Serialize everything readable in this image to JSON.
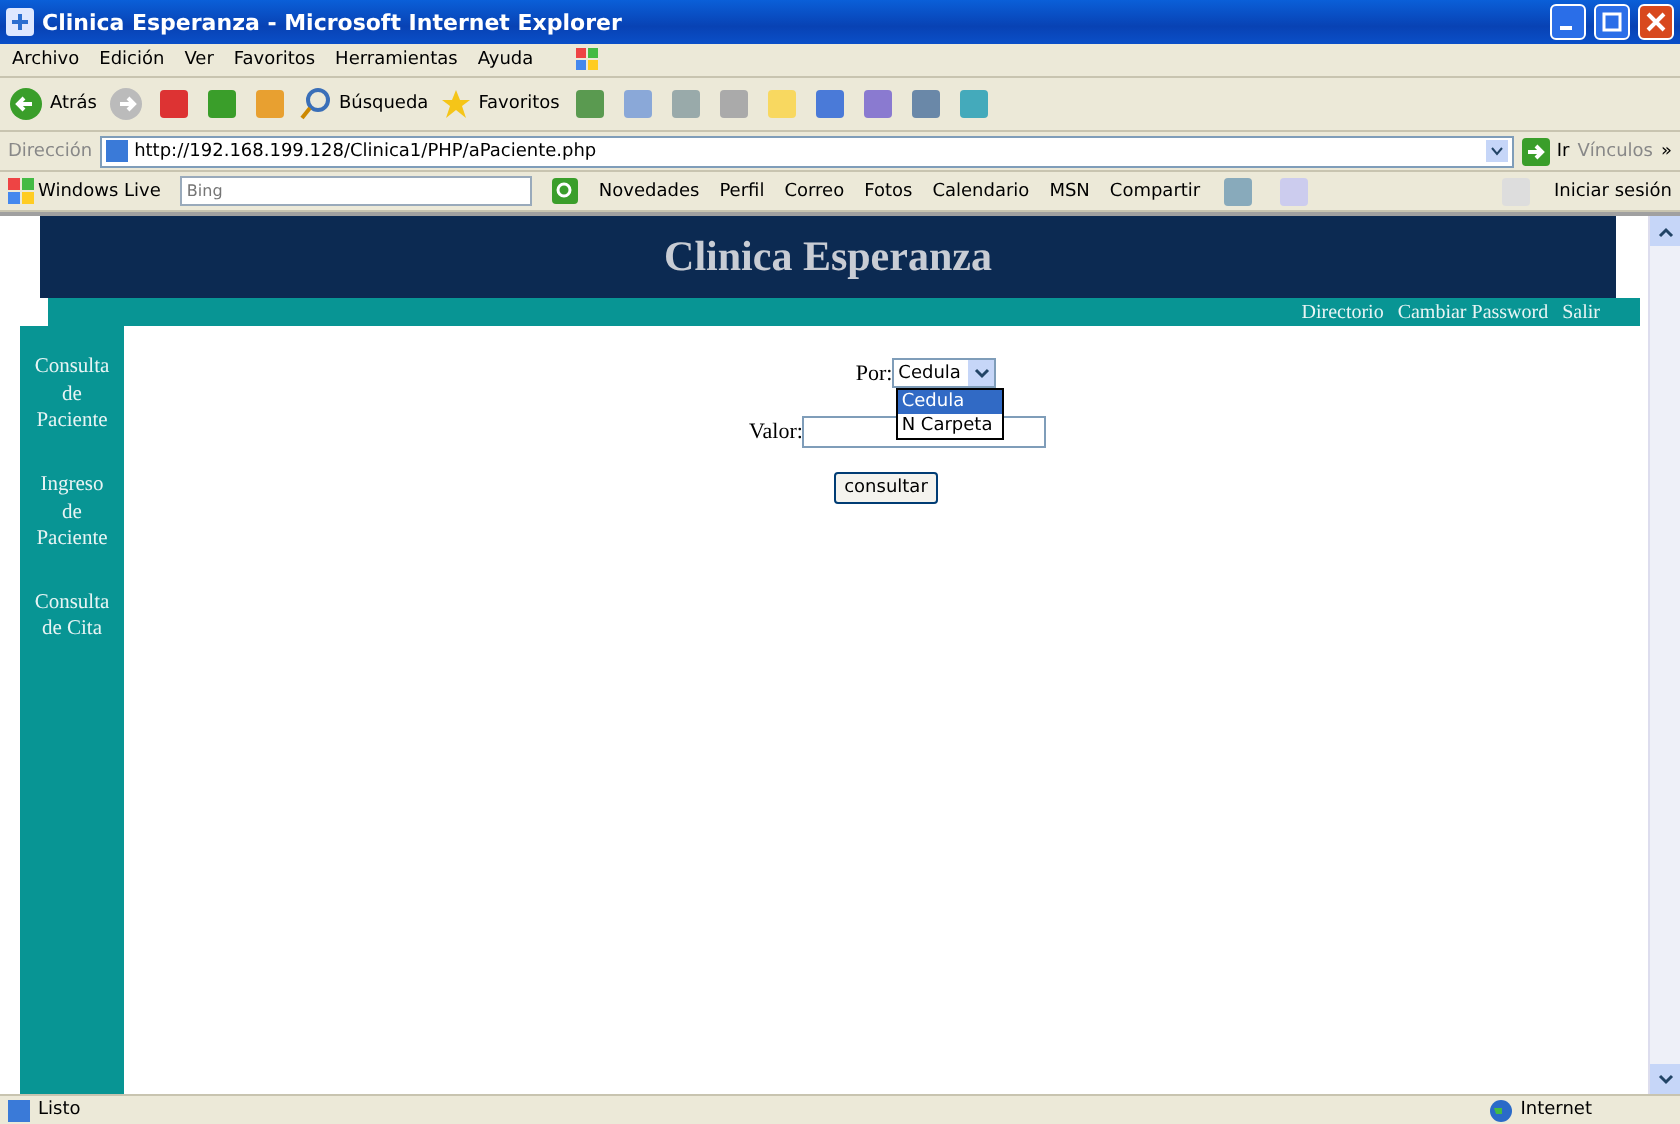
{
  "window": {
    "title": "Clinica Esperanza - Microsoft Internet Explorer"
  },
  "menu": [
    "Archivo",
    "Edición",
    "Ver",
    "Favoritos",
    "Herramientas",
    "Ayuda"
  ],
  "toolbar": {
    "back_label": "Atrás",
    "search_label": "Búsqueda",
    "favorites_label": "Favoritos"
  },
  "address_bar": {
    "label": "Dirección",
    "url": "http://192.168.199.128/Clinica1/PHP/aPaciente.php",
    "go_label": "Ir",
    "links_label": "Vínculos",
    "links_more": "»"
  },
  "live_bar": {
    "brand": "Windows Live",
    "search_placeholder": "Bing",
    "items": [
      "Novedades",
      "Perfil",
      "Correo",
      "Fotos",
      "Calendario",
      "MSN",
      "Compartir"
    ],
    "sign_in": "Iniciar sesión"
  },
  "page": {
    "header_title": "Clinica Esperanza",
    "top_links": [
      "Directorio",
      "Cambiar Password",
      "Salir"
    ],
    "sidebar": [
      "Consulta de Paciente",
      "Ingreso de Paciente",
      "Consulta de Cita"
    ],
    "form": {
      "por_label": "Por:",
      "select_value": "Cedula",
      "select_open": true,
      "options": [
        {
          "label": "Cedula",
          "selected": true
        },
        {
          "label": "N Carpeta",
          "selected": false
        }
      ],
      "valor_label": "Valor:",
      "button": "consultar"
    }
  },
  "status_bar": {
    "text": "Listo",
    "zone": "Internet"
  }
}
